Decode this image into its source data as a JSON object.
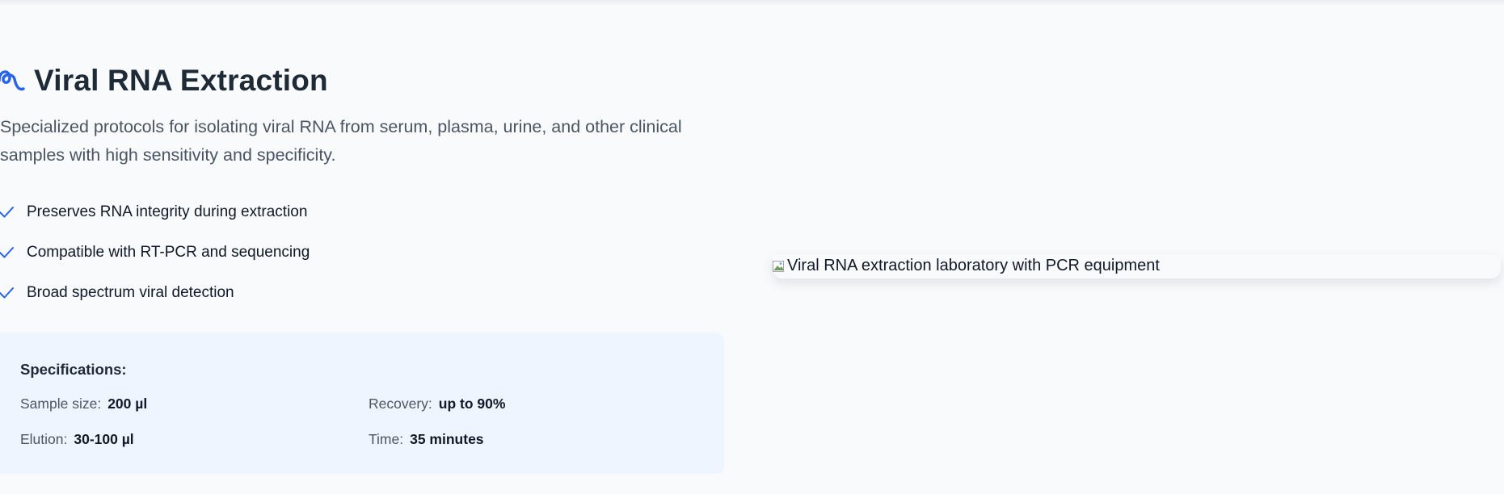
{
  "section": {
    "title": "Viral RNA Extraction",
    "title_icon": "rna-squiggle-icon",
    "description": "Specialized protocols for isolating viral RNA from serum, plasma, urine, and other clinical samples with high sensitivity and specificity.",
    "features": [
      "Preserves RNA integrity during extraction",
      "Compatible with RT-PCR and sequencing",
      "Broad spectrum viral detection"
    ],
    "feature_icon": "check-icon"
  },
  "specifications": {
    "heading": "Specifications:",
    "items": [
      {
        "label": "Sample size:",
        "value": "200 µl"
      },
      {
        "label": "Recovery:",
        "value": "up to 90%"
      },
      {
        "label": "Elution:",
        "value": "30-100 µl"
      },
      {
        "label": "Time:",
        "value": "35 minutes"
      }
    ]
  },
  "image": {
    "alt": "Viral RNA extraction laboratory with PCR equipment",
    "icon": "broken-image-icon"
  },
  "colors": {
    "accent": "#2563eb",
    "spec_background": "#eef5ff",
    "page_background": "#f8fafc"
  }
}
